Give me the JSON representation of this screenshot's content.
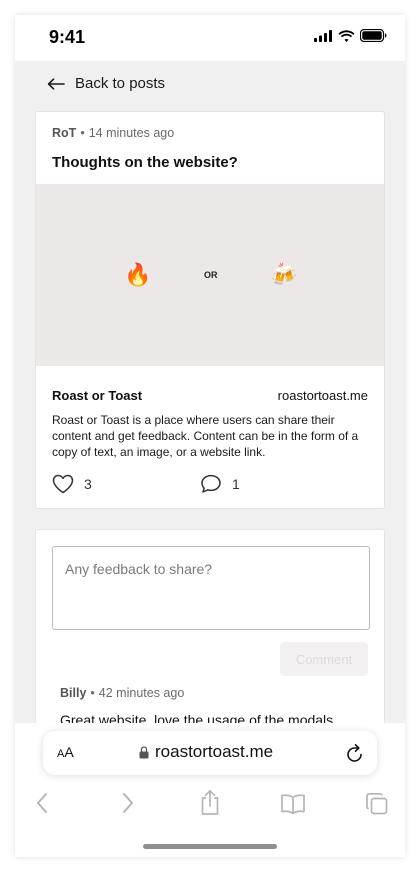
{
  "status_bar": {
    "time": "9:41"
  },
  "nav": {
    "back_label": "Back to posts"
  },
  "post": {
    "author": "RoT",
    "time_ago": "14 minutes ago",
    "title": "Thoughts on the website?",
    "preview": {
      "left_emoji": "🔥",
      "or_label": "OR",
      "right_emoji": "🍻"
    },
    "site_name": "Roast or Toast",
    "site_url": "roastortoast.me",
    "description": "Roast or Toast is a place where users can share their content and get feedback. Content can be in the form of a copy of text, an image, or a website link.",
    "likes": "3",
    "comments": "1"
  },
  "feedback": {
    "placeholder": "Any feedback to share?",
    "submit_label": "Comment"
  },
  "comment": {
    "author": "Billy",
    "time_ago": "42 minutes ago",
    "text": "Great website, love the usage of the modals"
  },
  "browser": {
    "aa_label_small": "A",
    "aa_label_large": "A",
    "url": "roastortoast.me"
  },
  "icons": {
    "back": "arrow-left-icon",
    "like": "heart-icon",
    "comment": "speech-bubble-icon",
    "lock": "lock-icon",
    "reload": "reload-icon",
    "back_nav": "chevron-left-icon",
    "forward_nav": "chevron-right-icon",
    "share": "share-icon",
    "bookmarks": "book-icon",
    "tabs": "tabs-icon"
  },
  "colors": {
    "page_bg": "#f1f0f0",
    "preview_bg": "#ece8e7",
    "card_border": "#e4e2e2"
  }
}
